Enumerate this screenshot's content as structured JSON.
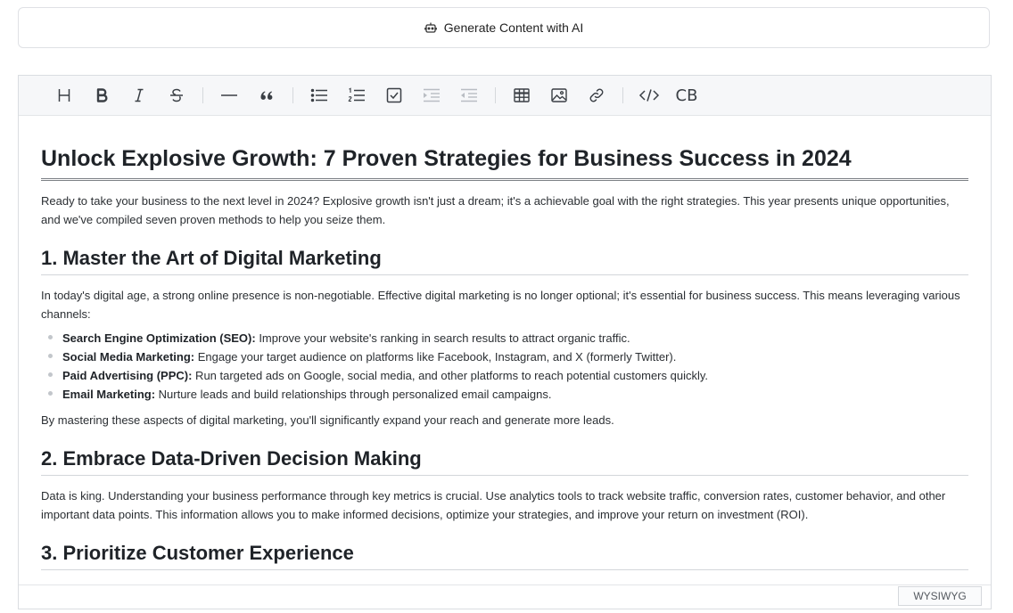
{
  "generate_button": {
    "label": "Generate Content with AI",
    "icon": "robot-icon"
  },
  "toolbar": {
    "items": [
      "heading",
      "bold",
      "italic",
      "strikethrough",
      "horizontal-rule",
      "blockquote",
      "bullet-list",
      "ordered-list",
      "task-list",
      "indent",
      "outdent",
      "table",
      "image",
      "link",
      "code",
      "code-block"
    ],
    "code_block_label": "CB"
  },
  "document": {
    "title": "Unlock Explosive Growth: 7 Proven Strategies for Business Success in 2024",
    "intro": "Ready to take your business to the next level in 2024? Explosive growth isn't just a dream; it's a achievable goal with the right strategies. This year presents unique opportunities, and we've compiled seven proven methods to help you seize them.",
    "sections": [
      {
        "heading": "1. Master the Art of Digital Marketing",
        "paragraph": "In today's digital age, a strong online presence is non-negotiable. Effective digital marketing is no longer optional; it's essential for business success. This means leveraging various channels:",
        "list": [
          {
            "term": "Search Engine Optimization (SEO):",
            "text": " Improve your website's ranking in search results to attract organic traffic."
          },
          {
            "term": "Social Media Marketing:",
            "text": " Engage your target audience on platforms like Facebook, Instagram, and X (formerly Twitter)."
          },
          {
            "term": "Paid Advertising (PPC):",
            "text": " Run targeted ads on Google, social media, and other platforms to reach potential customers quickly."
          },
          {
            "term": "Email Marketing:",
            "text": " Nurture leads and build relationships through personalized email campaigns."
          }
        ],
        "closing": "By mastering these aspects of digital marketing, you'll significantly expand your reach and generate more leads."
      },
      {
        "heading": "2. Embrace Data-Driven Decision Making",
        "paragraph": "Data is king. Understanding your business performance through key metrics is crucial. Use analytics tools to track website traffic, conversion rates, customer behavior, and other important data points. This information allows you to make informed decisions, optimize your strategies, and improve your return on investment (ROI)."
      },
      {
        "heading": "3. Prioritize Customer Experience"
      }
    ]
  },
  "footer": {
    "mode_label": "WYSIWYG"
  }
}
